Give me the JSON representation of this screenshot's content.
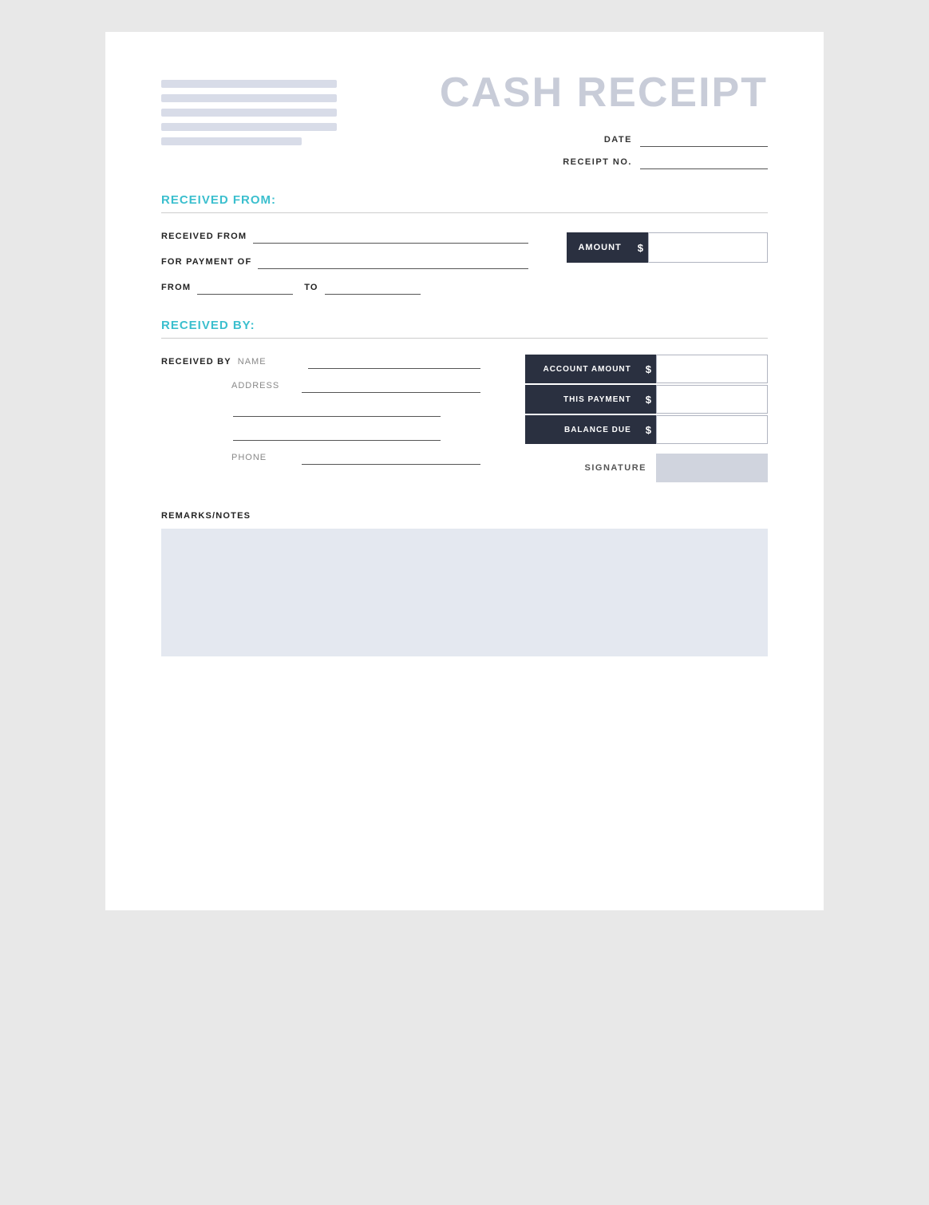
{
  "header": {
    "title": "CASH RECEIPT",
    "date_label": "DATE",
    "receipt_no_label": "RECEIPT NO."
  },
  "received_from_section": {
    "title": "RECEIVED FROM:",
    "received_from_label": "RECEIVED FROM",
    "for_payment_of_label": "FOR PAYMENT OF",
    "from_label": "FROM",
    "to_label": "TO",
    "amount_label": "AMOUNT",
    "dollar_sign": "$"
  },
  "received_by_section": {
    "title": "RECEIVED BY:",
    "received_by_label": "RECEIVED BY",
    "name_label": "NAME",
    "address_label": "ADDRESS",
    "phone_label": "PHONE",
    "account_amount_label": "ACCOUNT AMOUNT",
    "this_payment_label": "THIS PAYMENT",
    "balance_due_label": "BALANCE DUE",
    "dollar_sign": "$",
    "signature_label": "SIGNATURE"
  },
  "remarks_section": {
    "label": "REMARKS/NOTES"
  },
  "colors": {
    "teal": "#3bbfce",
    "dark": "#2a3040",
    "light_bg": "#e4e8f0",
    "logo_bg": "#d8dce8",
    "title_color": "#c8ccd8"
  }
}
